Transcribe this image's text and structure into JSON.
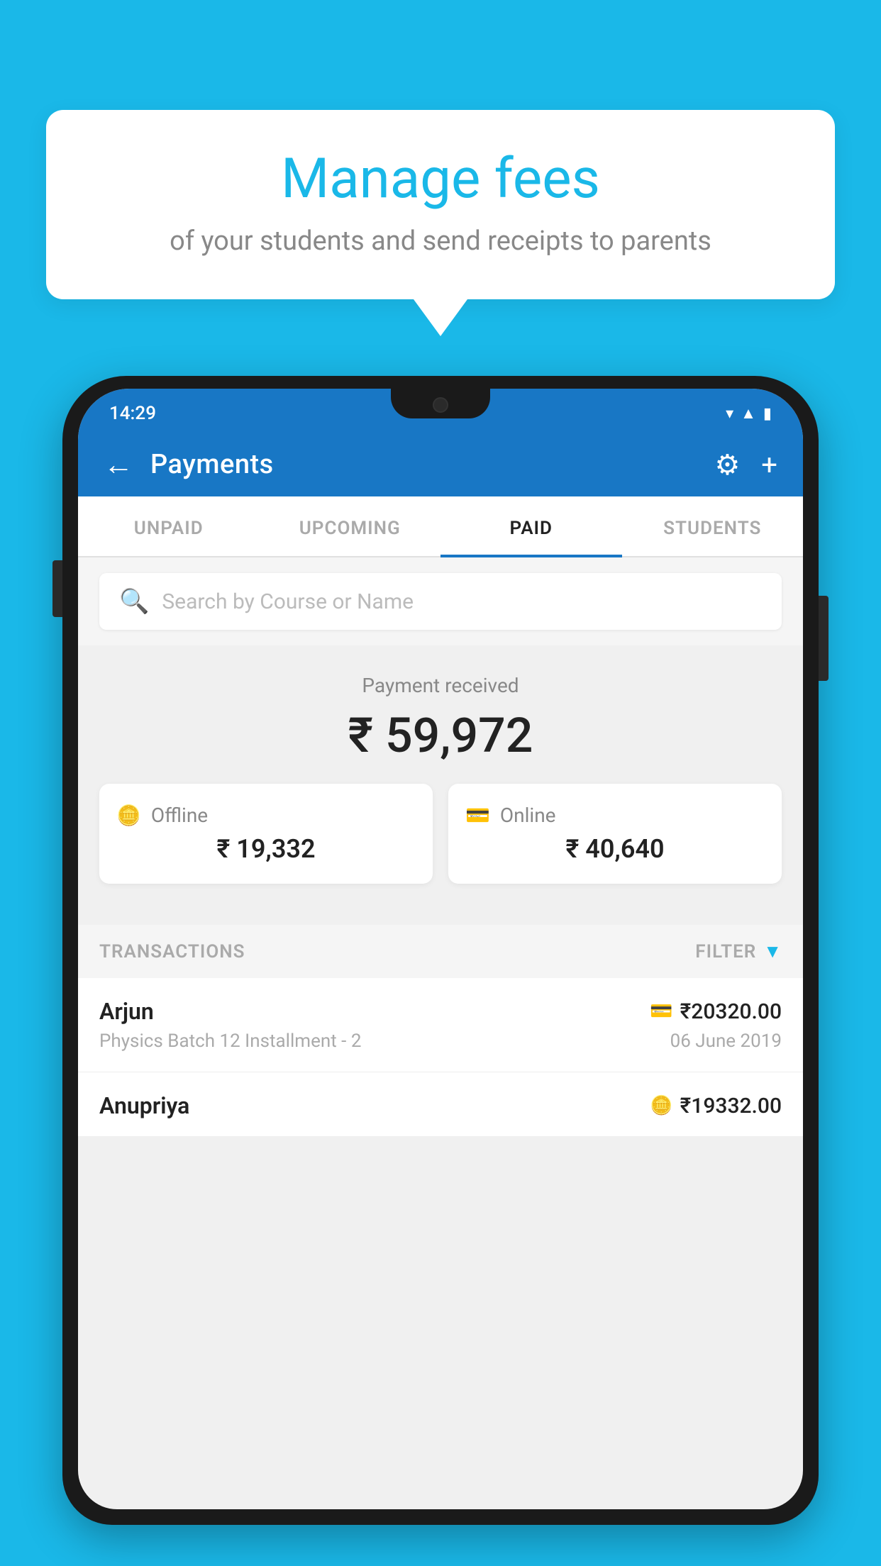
{
  "background_color": "#1ab8e8",
  "speech_bubble": {
    "title": "Manage fees",
    "subtitle": "of your students and send receipts to parents"
  },
  "status_bar": {
    "time": "14:29",
    "icons": [
      "wifi",
      "signal",
      "battery"
    ]
  },
  "header": {
    "back_label": "←",
    "title": "Payments",
    "gear_label": "⚙",
    "plus_label": "+"
  },
  "tabs": [
    {
      "label": "UNPAID",
      "active": false
    },
    {
      "label": "UPCOMING",
      "active": false
    },
    {
      "label": "PAID",
      "active": true
    },
    {
      "label": "STUDENTS",
      "active": false
    }
  ],
  "search": {
    "placeholder": "Search by Course or Name"
  },
  "payment_received": {
    "label": "Payment received",
    "amount": "₹ 59,972",
    "offline": {
      "type": "Offline",
      "amount": "₹ 19,332"
    },
    "online": {
      "type": "Online",
      "amount": "₹ 40,640"
    }
  },
  "transactions": {
    "label": "TRANSACTIONS",
    "filter_label": "FILTER",
    "rows": [
      {
        "name": "Arjun",
        "amount": "₹20320.00",
        "course": "Physics Batch 12 Installment - 2",
        "date": "06 June 2019",
        "payment_type": "card"
      },
      {
        "name": "Anupriya",
        "amount": "₹19332.00",
        "payment_type": "offline"
      }
    ]
  }
}
